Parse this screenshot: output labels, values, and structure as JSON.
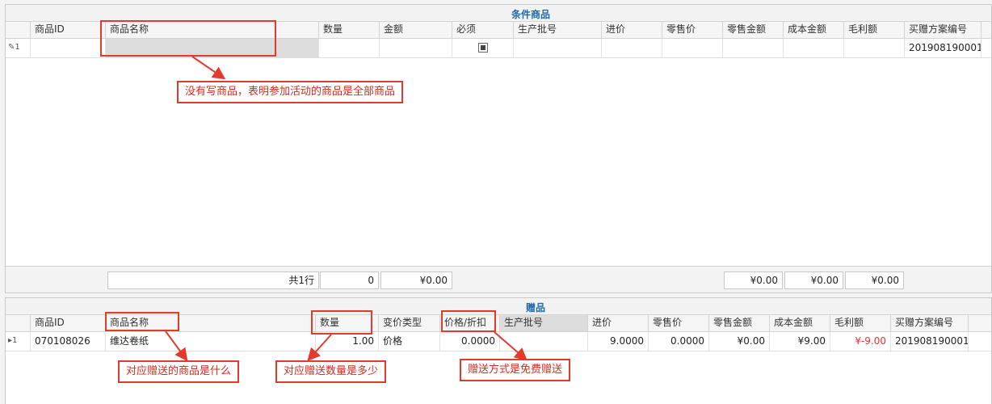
{
  "condition_panel": {
    "title": "条件商品",
    "headers": [
      "商品ID",
      "商品名称",
      "数量",
      "金额",
      "必须",
      "生产批号",
      "进价",
      "零售价",
      "零售金额",
      "成本金额",
      "毛利额",
      "买赠方案编号"
    ],
    "row": {
      "indicator": "1",
      "product_id": "",
      "product_name": "",
      "qty": "",
      "amount": "",
      "required_checked": true,
      "batch": "",
      "purchase_price": "",
      "retail_price": "",
      "retail_amount": "",
      "cost_amount": "",
      "gross_profit": "",
      "plan_no": "201908190001"
    },
    "footer": {
      "row_count": "共1行",
      "qty_total": "0",
      "amount_total": "¥0.00",
      "cost_total": "¥0.00",
      "cost_amount_total": "¥0.00",
      "gross_total": "¥0.00"
    }
  },
  "gift_panel": {
    "title": "赠品",
    "headers": [
      "商品ID",
      "商品名称",
      "数量",
      "变价类型",
      "价格/折扣",
      "生产批号",
      "进价",
      "零售价",
      "零售金额",
      "成本金额",
      "毛利额",
      "买赠方案编号"
    ],
    "row": {
      "indicator": "1",
      "product_id": "070108026",
      "product_name": "维达卷纸",
      "qty": "1.00",
      "price_type": "价格",
      "price_discount": "0.0000",
      "batch": "",
      "purchase_price": "9.0000",
      "retail_price": "0.0000",
      "retail_amount": "¥0.00",
      "cost_amount": "¥9.00",
      "gross_profit": "¥-9.00",
      "plan_no": "201908190001"
    }
  },
  "annotations": {
    "note1": "没有写商品，表明参加活动的商品是全部商品",
    "note2": "对应赠送的商品是什么",
    "note3": "对应赠送数量是多少",
    "note4": "赠送方式是免费赠送"
  },
  "colors": {
    "accent": "#1f6aa8",
    "annotation": "#e23b2e",
    "negative": "#e53333"
  }
}
